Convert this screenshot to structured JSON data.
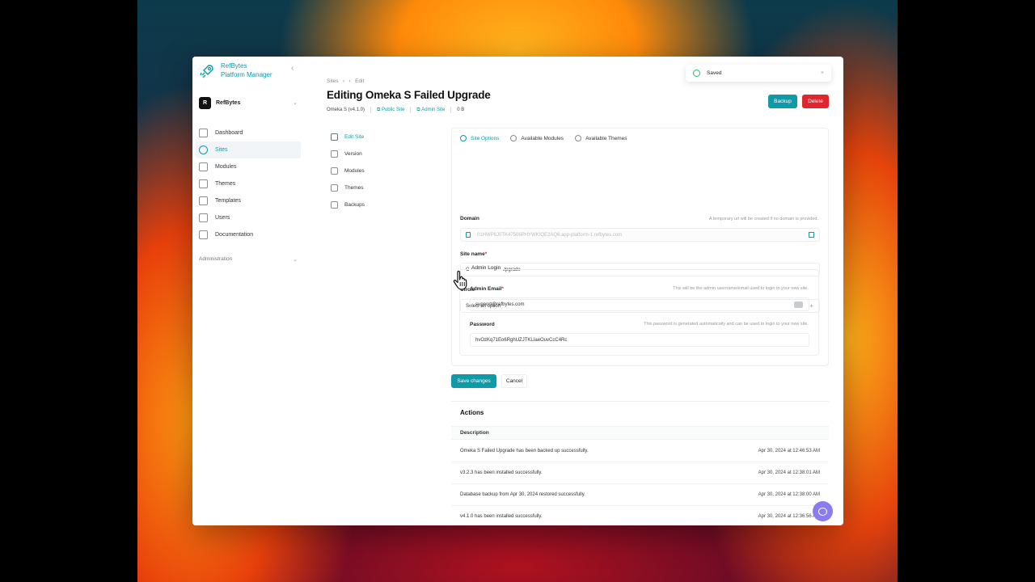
{
  "brand": {
    "name_line1": "RefBytes",
    "name_line2": "Platform Manager"
  },
  "team": {
    "initial": "R",
    "name": "RefBytes"
  },
  "sidebar": {
    "items": [
      {
        "label": "Dashboard",
        "icon": "home-icon"
      },
      {
        "label": "Sites",
        "icon": "globe-icon",
        "active": true
      },
      {
        "label": "Modules",
        "icon": "cube-icon"
      },
      {
        "label": "Themes",
        "icon": "columns-icon"
      },
      {
        "label": "Templates",
        "icon": "template-icon"
      },
      {
        "label": "Users",
        "icon": "users-icon"
      },
      {
        "label": "Documentation",
        "icon": "doc-icon"
      }
    ],
    "admin_label": "Administration"
  },
  "breadcrumb": {
    "parent": "Sites",
    "current": "Edit"
  },
  "page": {
    "title": "Editing Omeka S Failed Upgrade",
    "version": "Omeka S (v4.1.0)",
    "public_site": "Public Site",
    "admin_site": "Admin Site",
    "size": "0 B"
  },
  "header_buttons": {
    "backup": "Backup",
    "delete": "Delete"
  },
  "toast": {
    "text": "Saved",
    "close": "×"
  },
  "subnav": {
    "items": [
      {
        "label": "Edit Site",
        "active": true
      },
      {
        "label": "Version"
      },
      {
        "label": "Modules"
      },
      {
        "label": "Themes"
      },
      {
        "label": "Backups"
      }
    ]
  },
  "tabs": [
    {
      "label": "Site Options",
      "active": true
    },
    {
      "label": "Available Modules"
    },
    {
      "label": "Available Themes"
    }
  ],
  "form": {
    "domain_label": "Domain",
    "domain_help": "A temporary url will be created if no domain is provided.",
    "domain_value": "01HWP6J0TK47506PHYWKIQE2AQ6.app-platform-1.refbytes.com",
    "site_name_label": "Site name",
    "site_name_value": "Omeka S Failed Upgrade",
    "circle_label": "Circle",
    "circle_value": "Select an option",
    "admin_login_legend": "Admin Login",
    "admin_email_label": "Admin Email",
    "admin_email_help": "This will be the admin username/email used to login to your new site.",
    "admin_email_value": "support@refbytes.com",
    "password_label": "Password",
    "password_help": "This password is generated automatically and can be used to login to your new site.",
    "password_value": "hvOzKq71Eo6RghUZJTKLIaeOuvCcC4Rc",
    "save_label": "Save changes",
    "cancel_label": "Cancel"
  },
  "actions": {
    "title": "Actions",
    "column": "Description",
    "rows": [
      {
        "desc": "Omeka S Failed Upgrade has been backed up successfully.",
        "date": "Apr 30, 2024 at 12:46:53 AM"
      },
      {
        "desc": "v3.2.3 has been installed successfully.",
        "date": "Apr 30, 2024 at 12:38:01 AM"
      },
      {
        "desc": "Database backup from Apr 30, 2024 restored successfully.",
        "date": "Apr 30, 2024 at 12:38:00 AM"
      },
      {
        "desc": "v4.1.0 has been installed successfully.",
        "date": "Apr 30, 2024 at 12:36:56 AM"
      }
    ]
  },
  "colors": {
    "accent": "#0e9aa7",
    "danger": "#e0262f",
    "chat": "#8a7cf0"
  }
}
